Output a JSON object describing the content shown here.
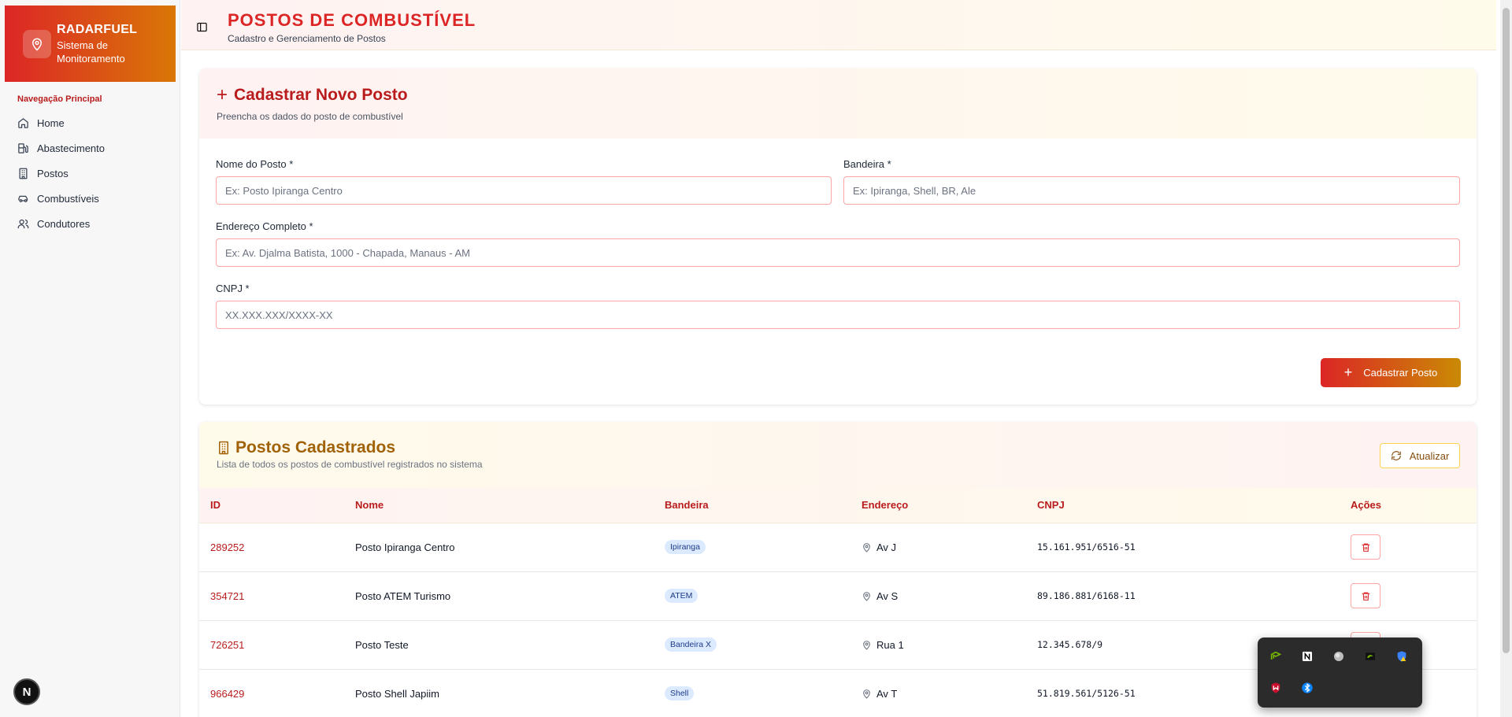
{
  "sidebar": {
    "brand_title": "RADARFUEL",
    "brand_subtitle": "Sistema de Monitoramento",
    "section_label": "Navegação Principal",
    "items": [
      {
        "label": "Home",
        "icon": "home-icon"
      },
      {
        "label": "Abastecimento",
        "icon": "fuel-pump-icon"
      },
      {
        "label": "Postos",
        "icon": "building-icon"
      },
      {
        "label": "Combustíveis",
        "icon": "car-icon"
      },
      {
        "label": "Condutores",
        "icon": "users-icon"
      }
    ],
    "dev_badge": "N"
  },
  "header": {
    "title": "POSTOS DE COMBUSTÍVEL",
    "subtitle": "Cadastro e Gerenciamento de Postos"
  },
  "form_card": {
    "title": "Cadastrar Novo Posto",
    "subtitle": "Preencha os dados do posto de combustível",
    "fields": {
      "nome": {
        "label": "Nome do Posto *",
        "placeholder": "Ex: Posto Ipiranga Centro"
      },
      "bandeira": {
        "label": "Bandeira *",
        "placeholder": "Ex: Ipiranga, Shell, BR, Ale"
      },
      "endereco": {
        "label": "Endereço Completo *",
        "placeholder": "Ex: Av. Djalma Batista, 1000 - Chapada, Manaus - AM"
      },
      "cnpj": {
        "label": "CNPJ *",
        "placeholder": "XX.XXX.XXX/XXXX-XX"
      }
    },
    "submit_label": "Cadastrar Posto"
  },
  "list_card": {
    "title": "Postos Cadastrados",
    "subtitle": "Lista de todos os postos de combustível registrados no sistema",
    "refresh_label": "Atualizar",
    "columns": [
      "ID",
      "Nome",
      "Bandeira",
      "Endereço",
      "CNPJ",
      "Ações"
    ],
    "rows": [
      {
        "id": "289252",
        "nome": "Posto Ipiranga Centro",
        "bandeira": "Ipiranga",
        "endereco": "Av J",
        "cnpj": "15.161.951/6516-51"
      },
      {
        "id": "354721",
        "nome": "Posto ATEM Turismo",
        "bandeira": "ATEM",
        "endereco": "Av S",
        "cnpj": "89.186.881/6168-11"
      },
      {
        "id": "726251",
        "nome": "Posto Teste",
        "bandeira": "Bandeira X",
        "endereco": "Rua 1",
        "cnpj": "12.345.678/9"
      },
      {
        "id": "966429",
        "nome": "Posto Shell Japiim",
        "bandeira": "Shell",
        "endereco": "Av T",
        "cnpj": "51.819.561/5126-51"
      }
    ]
  },
  "tray": {
    "icons": [
      "nvidia-broadcast-icon",
      "notion-icon",
      "globe-icon",
      "nvidia-icon",
      "windows-security-icon",
      "mcafee-icon",
      "bluetooth-icon"
    ]
  },
  "colors": {
    "primary_red": "#dc2626",
    "accent_amber": "#d97706",
    "badge_blue": "#dbeafe"
  }
}
